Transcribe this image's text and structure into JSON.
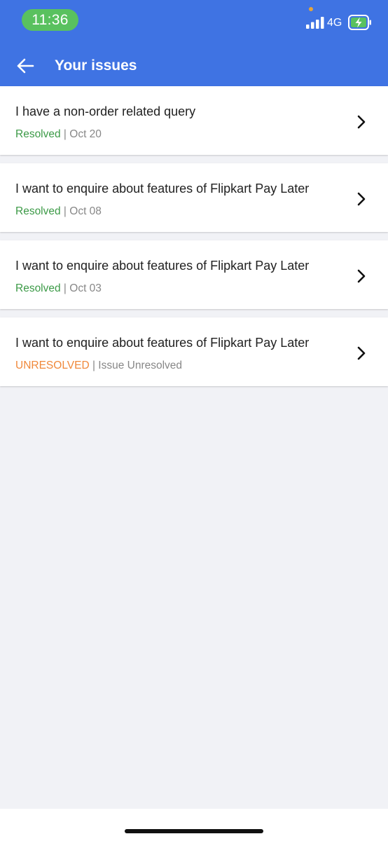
{
  "status_bar": {
    "time": "11:36",
    "network": "4G",
    "icons": [
      "signal-icon",
      "battery-charging-icon"
    ],
    "colors": {
      "time_pill": "#59c15f",
      "camera_dot": "#e5a43a"
    }
  },
  "header": {
    "title": "Your issues",
    "back_icon": "back-arrow-icon",
    "background": "#3f73e3"
  },
  "issues": [
    {
      "title": "I have a non-order related query",
      "status": "Resolved",
      "separator": " | ",
      "detail": "Oct 20",
      "status_color": "#3c9a47"
    },
    {
      "title": "I want to enquire about features of Flipkart Pay Later",
      "status": "Resolved",
      "separator": " | ",
      "detail": "Oct 08",
      "status_color": "#3c9a47"
    },
    {
      "title": "I want to enquire about features of Flipkart Pay Later",
      "status": "Resolved",
      "separator": " | ",
      "detail": "Oct 03",
      "status_color": "#3c9a47"
    },
    {
      "title": "I want to enquire about features of Flipkart Pay Later",
      "status": "UNRESOLVED",
      "separator": " | ",
      "detail": "Issue Unresolved",
      "status_color": "#f0883a"
    }
  ],
  "chevron_icon": "chevron-right-icon"
}
